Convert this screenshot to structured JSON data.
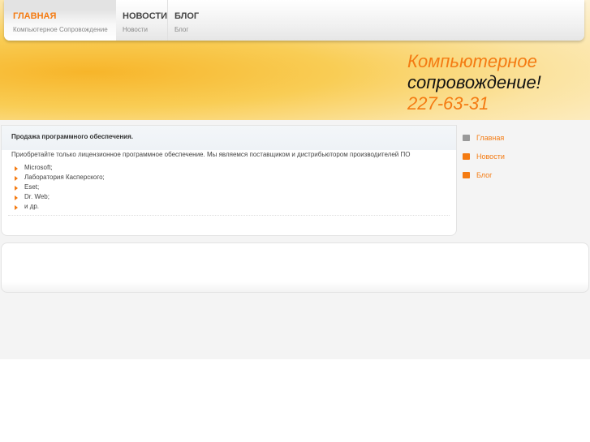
{
  "nav": [
    {
      "title": "ГЛАВНАЯ",
      "sub": "Компьютерное Сопровождение"
    },
    {
      "title": "НОВОСТИ",
      "sub": "Новости"
    },
    {
      "title": "БЛОГ",
      "sub": "Блог"
    }
  ],
  "slogan": {
    "line1": "Компьютерное",
    "line2": "сопровождение!",
    "phone": "227-63-31"
  },
  "content": {
    "title": "Продажа программного обеспечения.",
    "text": "Приобретайте только лицензионное программное обеспечение. Мы являемся поставщиком и дистрибьютором производителей ПО",
    "items": [
      "Microsoft;",
      "Лаборатория Касперского;",
      "Eset;",
      "Dr. Web;",
      "и др."
    ]
  },
  "sidebar": [
    "Главная",
    "Новости",
    "Блог"
  ]
}
